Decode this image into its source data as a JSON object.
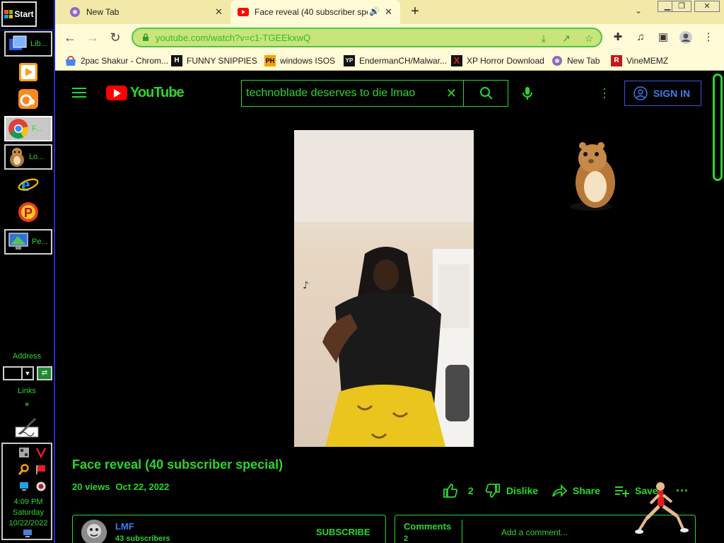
{
  "taskbar": {
    "start_label": "Start",
    "items": [
      {
        "label": "Lib..."
      },
      {
        "label": "F..."
      },
      {
        "label": "Lo..."
      },
      {
        "label": "Pe..."
      }
    ],
    "address_label": "Address",
    "links_label": "Links",
    "chevron": "»",
    "tray": {
      "time": "4:09 PM",
      "day": "Saturday",
      "date": "10/22/2022"
    }
  },
  "browser": {
    "tabs": [
      {
        "title": "New Tab",
        "active": false
      },
      {
        "title": "Face reveal (40 subscriber spe",
        "active": true
      }
    ],
    "url": "youtube.com/watch?v=c1-TGEEkxwQ",
    "bookmarks": [
      {
        "label": "2pac Shakur - Chrom...",
        "icon": "chrome-web-store-icon"
      },
      {
        "label": "FUNNY SNIPPIES",
        "icon": "H"
      },
      {
        "label": "windows ISOS",
        "icon": "PH"
      },
      {
        "label": "EndermanCH/Malwar...",
        "icon": "YP"
      },
      {
        "label": "XP Horror Download",
        "icon": "X"
      },
      {
        "label": "New Tab",
        "icon": "extension-icon"
      },
      {
        "label": "VineMEMZ",
        "icon": "R"
      }
    ]
  },
  "youtube": {
    "logo_text": "YouTube",
    "search_query": "technoblade deserves to die lmao",
    "sign_in": "SIGN IN",
    "video": {
      "title": "Face reveal (40 subscriber special)",
      "views": "20 views",
      "date": "Oct 22, 2022",
      "likes": "2",
      "dislike_label": "Dislike",
      "share_label": "Share",
      "save_label": "Save"
    },
    "channel": {
      "name": "LMF",
      "subscribers": "43 subscribers",
      "subscribe_label": "SUBSCRIBE"
    },
    "comments": {
      "label": "Comments",
      "count": "2",
      "add_placeholder": "Add a comment..."
    }
  },
  "colors": {
    "accent": "#2bd62b",
    "link": "#3b7cf0",
    "tabstrip": "#f2e9a8",
    "toolbar": "#fffbd6"
  }
}
